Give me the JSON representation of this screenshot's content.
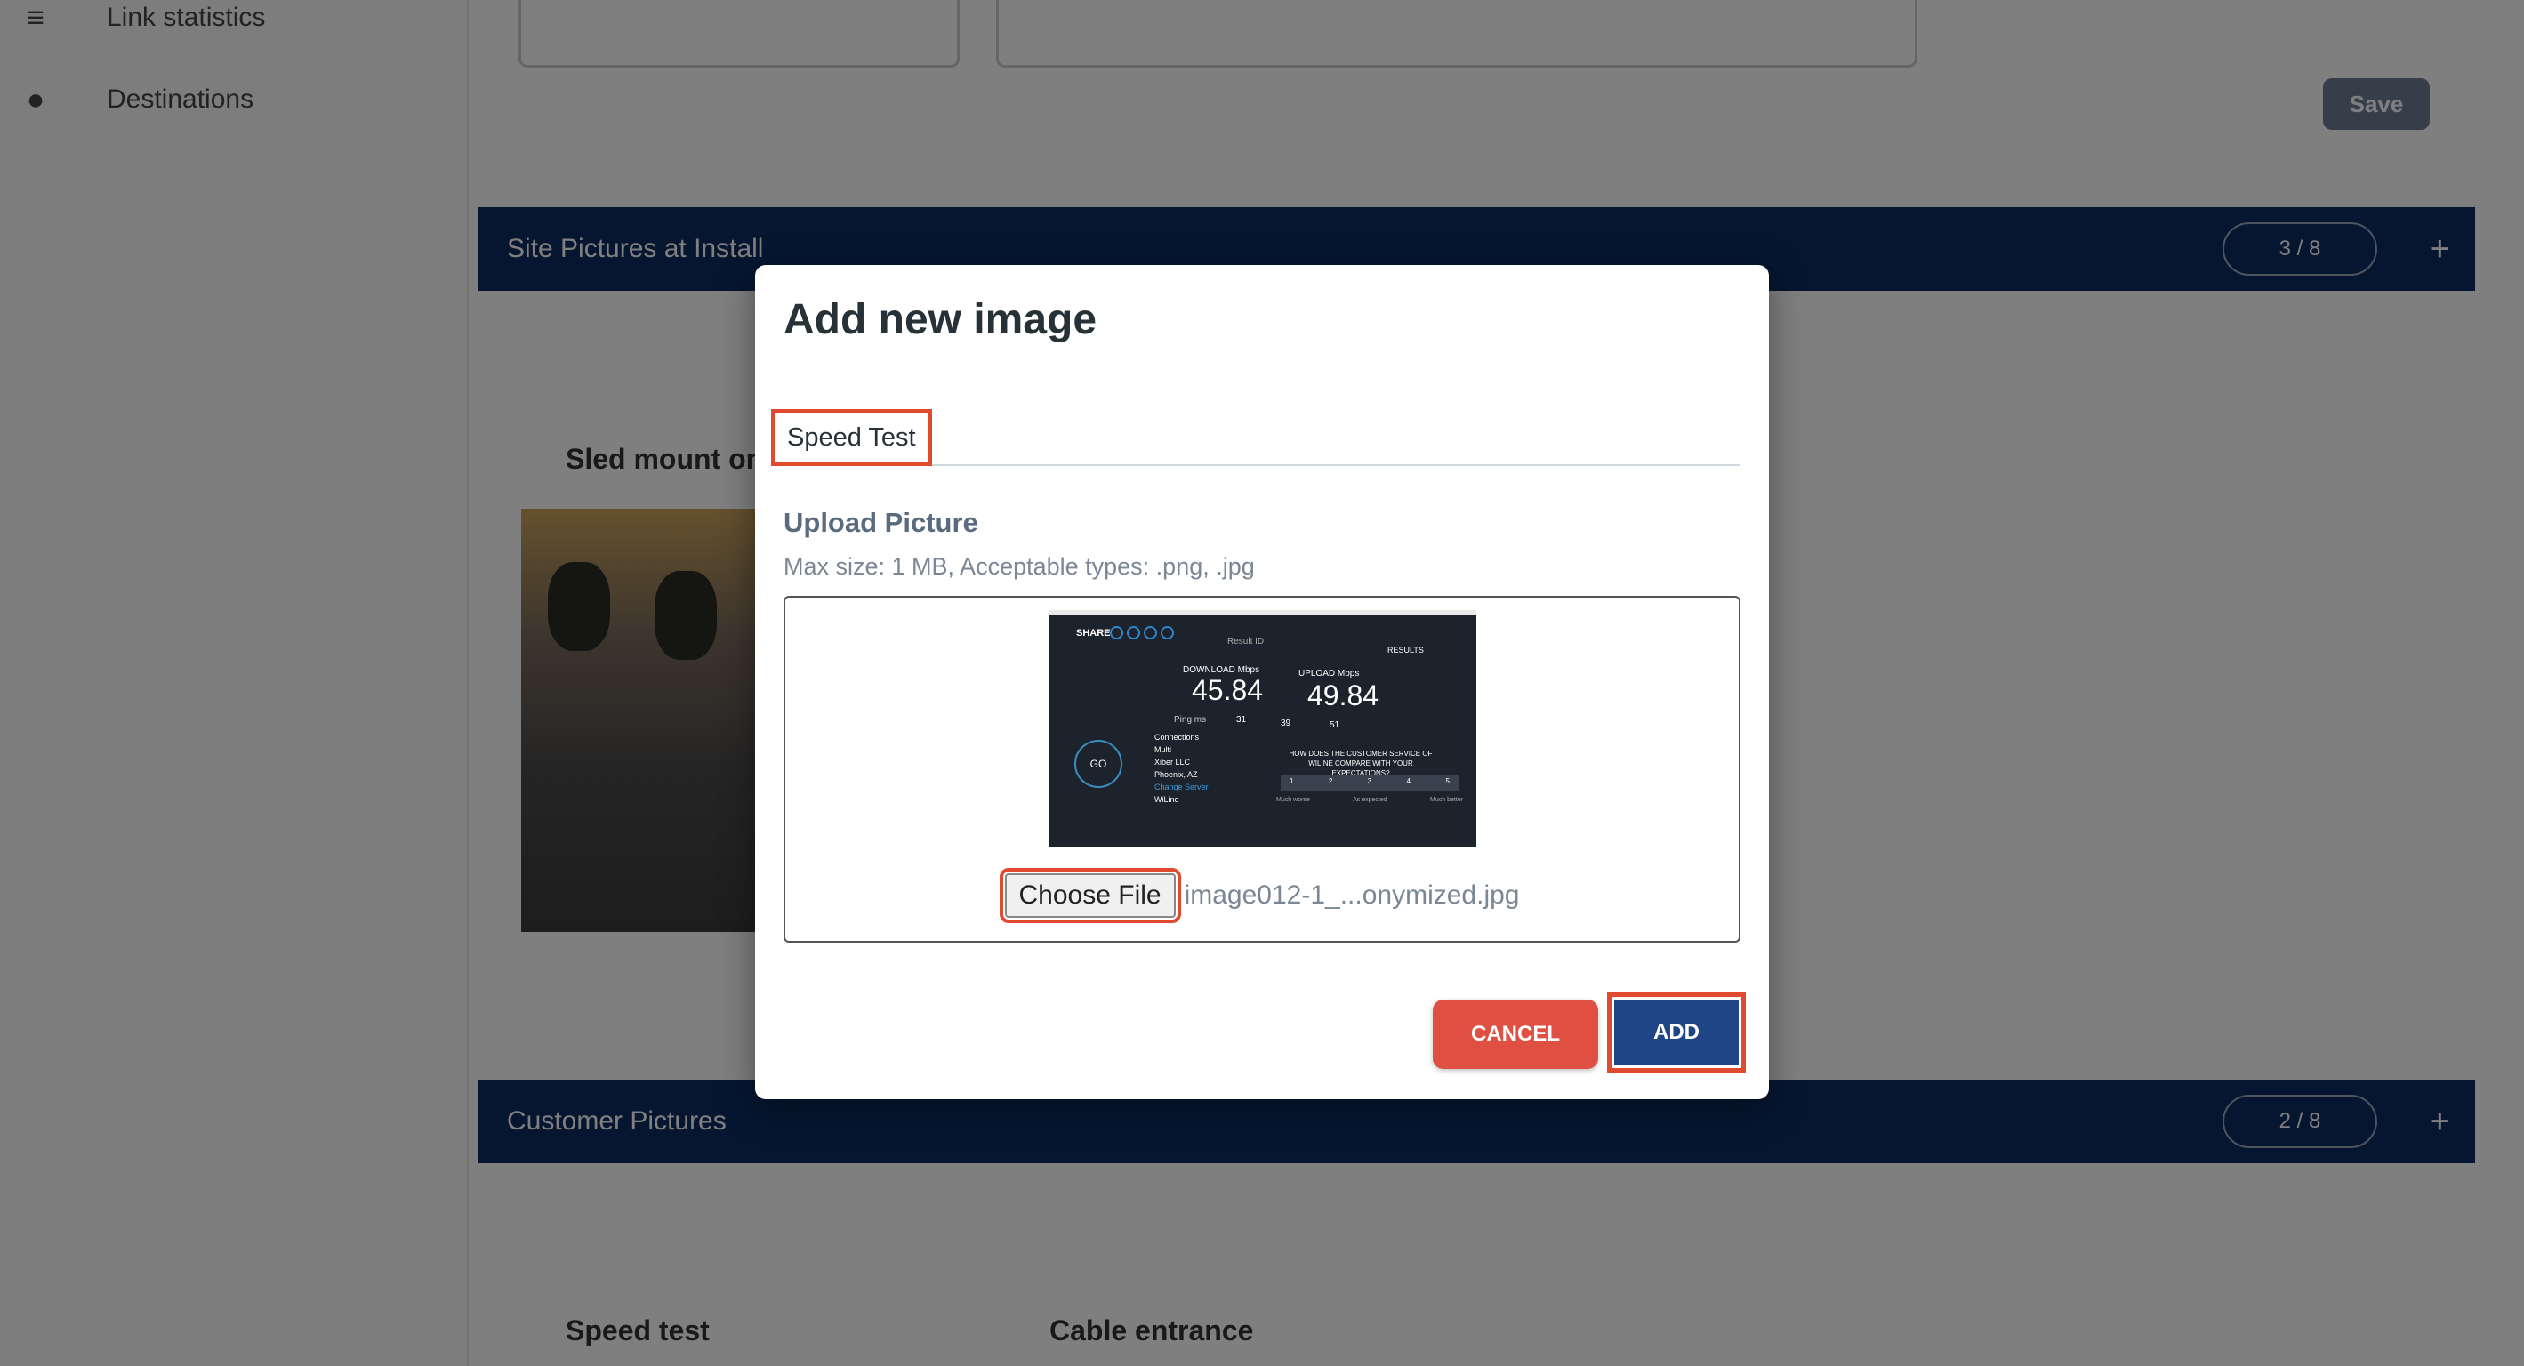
{
  "sidebar": {
    "items": [
      {
        "label": "Link statistics",
        "icon": "chart-icon"
      },
      {
        "label": "Destinations",
        "icon": "globe-icon"
      }
    ]
  },
  "page": {
    "save_label": "Save",
    "section1": {
      "title": "Site Pictures at Install",
      "count": "3 / 8"
    },
    "section1_caption": "Sled mount on",
    "section2": {
      "title": "Customer Pictures",
      "count": "2 / 8"
    },
    "section2_captions": [
      "Speed test",
      "Cable entrance"
    ]
  },
  "modal": {
    "title": "Add new image",
    "name_value": "Speed Test",
    "upload_label": "Upload Picture",
    "hint": "Max size: 1 MB, Acceptable types: .png, .jpg",
    "choose_file_label": "Choose File",
    "file_name": "image012-1_...onymized.jpg",
    "cancel_label": "CANCEL",
    "add_label": "ADD",
    "preview": {
      "share": "SHARE",
      "result_id": "Result ID",
      "results": "RESULTS",
      "download_label": "DOWNLOAD Mbps",
      "download": "45.84",
      "upload_label": "UPLOAD Mbps",
      "upload": "49.84",
      "ping": "Ping ms",
      "ping_val": "31",
      "v2": "39",
      "v3": "51",
      "go": "GO",
      "connections": "Connections",
      "multi": "Multi",
      "isp": "Xiber LLC",
      "city": "Phoenix, AZ",
      "change_server": "Change Server",
      "provider": "WiLine",
      "survey": "HOW DOES THE CUSTOMER SERVICE OF WILINE COMPARE WITH YOUR EXPECTATIONS?",
      "scale": [
        "1",
        "2",
        "3",
        "4",
        "5"
      ],
      "scale_labels": [
        "Much worse",
        "As expected",
        "Much better"
      ]
    }
  },
  "colors": {
    "cancel": "#df4f42",
    "add": "#1f4587",
    "highlight": "#e04a2f",
    "section_bar": "#0d2c63"
  }
}
